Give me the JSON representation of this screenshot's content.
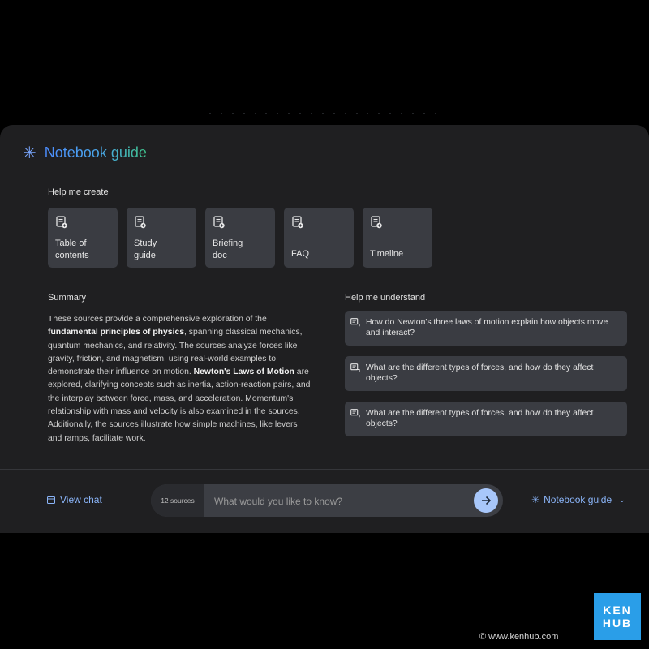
{
  "guide": {
    "title": "Notebook guide",
    "icon": "sparkle-icon"
  },
  "create": {
    "label": "Help me create",
    "cards": [
      {
        "label": "Table of contents"
      },
      {
        "label": "Study guide"
      },
      {
        "label": "Briefing doc"
      },
      {
        "label": "FAQ"
      },
      {
        "label": "Timeline"
      }
    ]
  },
  "summary": {
    "label": "Summary",
    "parts": [
      "These sources provide a comprehensive exploration of the ",
      "fundamental principles of physics",
      ", spanning classical mechanics, quantum mechanics, and relativity. The sources analyze forces like gravity, friction, and magnetism, using real-world examples to demonstrate their influence on motion. ",
      "Newton's Laws of Motion",
      " are explored, clarifying concepts such as inertia, action-reaction pairs, and the interplay between force, mass, and acceleration. Momentum's relationship with mass and velocity is also examined in the sources. Additionally, the sources illustrate how simple machines, like levers and ramps, facilitate work."
    ]
  },
  "understand": {
    "label": "Help me understand",
    "questions": [
      "How do Newton's three laws of motion explain how objects move and interact?",
      "What are the different types of forces, and how do they affect objects?",
      "What are the different types of forces, and how do they affect objects?"
    ]
  },
  "bottom": {
    "view_chat": "View chat",
    "sources": "12 sources",
    "placeholder": "What would you like to know?",
    "guide_toggle": "Notebook guide"
  },
  "watermark": {
    "logo_top": "KEN",
    "logo_bottom": "HUB",
    "credit": "© www.kenhub.com"
  },
  "colors": {
    "accent": "#8ab4f8",
    "send_button": "#a8c7fa",
    "card": "#3a3c42",
    "panel": "#1f1f21",
    "logo": "#2a9ee8"
  }
}
